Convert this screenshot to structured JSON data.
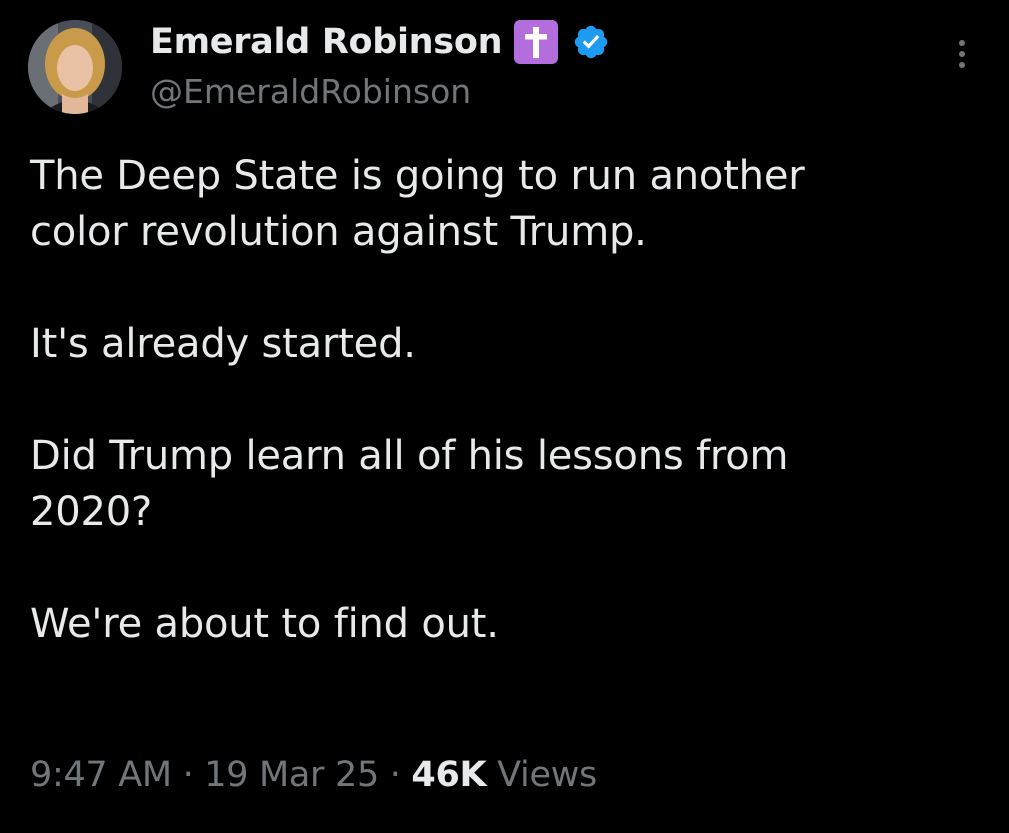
{
  "author": {
    "display_name": "Emerald Robinson",
    "handle": "@EmeraldRobinson",
    "badge_icon": "latin-cross-icon",
    "verified_icon": "verified-badge-icon",
    "verified_color": "#1d9bf0",
    "cross_badge_color": "#b46ddd"
  },
  "tweet": {
    "paragraphs": [
      "The Deep State is going to run another\ncolor revolution against Trump.",
      "It's already started.",
      "Did Trump learn all of his lessons from\n2020?",
      "We're about to find out."
    ],
    "time": "9:47 AM",
    "separator": "·",
    "date": "19 Mar 25",
    "views_count": "46K",
    "views_label": "Views"
  },
  "colors": {
    "background": "#000000",
    "primary_text": "#e7e9ea",
    "secondary_text": "#71767b"
  }
}
